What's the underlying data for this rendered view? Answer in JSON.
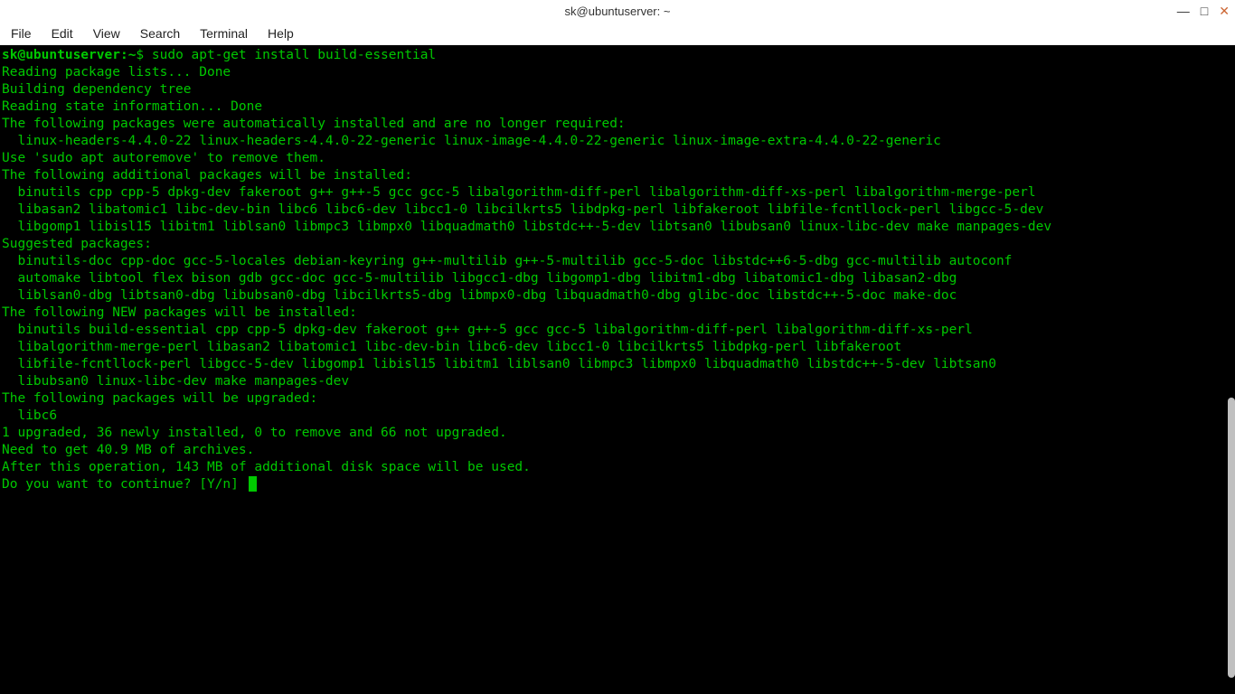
{
  "window": {
    "title": "sk@ubuntuserver: ~",
    "controls": {
      "minimize": "—",
      "maximize": "□",
      "close": "✕"
    }
  },
  "menu": {
    "items": [
      "File",
      "Edit",
      "View",
      "Search",
      "Terminal",
      "Help"
    ]
  },
  "terminal": {
    "prompt": {
      "user_host": "sk@ubuntuserver",
      "separator": ":",
      "path": "~",
      "dollar": "$",
      "command": " sudo apt-get install build-essential"
    },
    "lines": [
      "Reading package lists... Done",
      "Building dependency tree",
      "Reading state information... Done",
      "The following packages were automatically installed and are no longer required:",
      "  linux-headers-4.4.0-22 linux-headers-4.4.0-22-generic linux-image-4.4.0-22-generic linux-image-extra-4.4.0-22-generic",
      "Use 'sudo apt autoremove' to remove them.",
      "The following additional packages will be installed:",
      "  binutils cpp cpp-5 dpkg-dev fakeroot g++ g++-5 gcc gcc-5 libalgorithm-diff-perl libalgorithm-diff-xs-perl libalgorithm-merge-perl",
      "  libasan2 libatomic1 libc-dev-bin libc6 libc6-dev libcc1-0 libcilkrts5 libdpkg-perl libfakeroot libfile-fcntllock-perl libgcc-5-dev",
      "  libgomp1 libisl15 libitm1 liblsan0 libmpc3 libmpx0 libquadmath0 libstdc++-5-dev libtsan0 libubsan0 linux-libc-dev make manpages-dev",
      "Suggested packages:",
      "  binutils-doc cpp-doc gcc-5-locales debian-keyring g++-multilib g++-5-multilib gcc-5-doc libstdc++6-5-dbg gcc-multilib autoconf",
      "  automake libtool flex bison gdb gcc-doc gcc-5-multilib libgcc1-dbg libgomp1-dbg libitm1-dbg libatomic1-dbg libasan2-dbg",
      "  liblsan0-dbg libtsan0-dbg libubsan0-dbg libcilkrts5-dbg libmpx0-dbg libquadmath0-dbg glibc-doc libstdc++-5-doc make-doc",
      "The following NEW packages will be installed:",
      "  binutils build-essential cpp cpp-5 dpkg-dev fakeroot g++ g++-5 gcc gcc-5 libalgorithm-diff-perl libalgorithm-diff-xs-perl",
      "  libalgorithm-merge-perl libasan2 libatomic1 libc-dev-bin libc6-dev libcc1-0 libcilkrts5 libdpkg-perl libfakeroot",
      "  libfile-fcntllock-perl libgcc-5-dev libgomp1 libisl15 libitm1 liblsan0 libmpc3 libmpx0 libquadmath0 libstdc++-5-dev libtsan0",
      "  libubsan0 linux-libc-dev make manpages-dev",
      "The following packages will be upgraded:",
      "  libc6",
      "1 upgraded, 36 newly installed, 0 to remove and 66 not upgraded.",
      "Need to get 40.9 MB of archives.",
      "After this operation, 143 MB of additional disk space will be used.",
      "Do you want to continue? [Y/n] "
    ]
  }
}
